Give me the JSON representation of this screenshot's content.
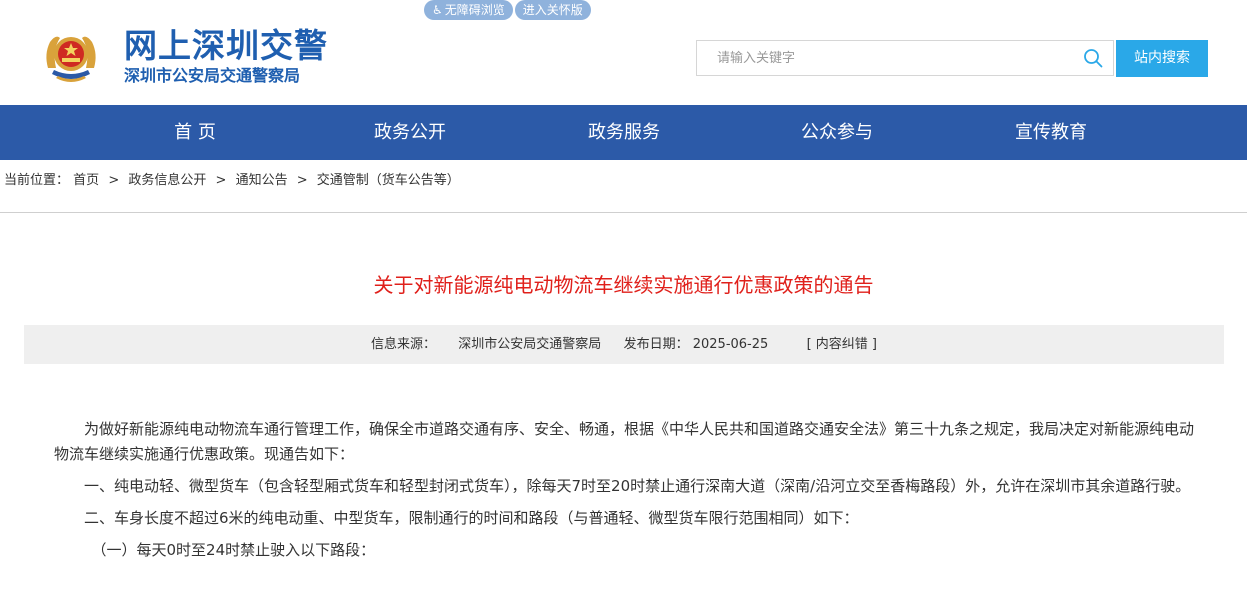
{
  "accessibility": {
    "barrier_free_label": "无障碍浏览",
    "elderly_mode_label": "进入关怀版"
  },
  "site": {
    "title": "网上深圳交警",
    "subtitle": "深圳市公安局交通警察局"
  },
  "search": {
    "placeholder": "请输入关键字",
    "value": "",
    "button_label": "站内搜索"
  },
  "nav": {
    "items": [
      {
        "label": "首 页"
      },
      {
        "label": "政务公开"
      },
      {
        "label": "政务服务"
      },
      {
        "label": "公众参与"
      },
      {
        "label": "宣传教育"
      }
    ]
  },
  "breadcrumb": {
    "prefix": "当前位置：",
    "items": [
      "首页",
      "政务信息公开",
      "通知公告",
      "交通管制（货车公告等）"
    ],
    "separator": ">"
  },
  "article": {
    "title": "关于对新能源纯电动物流车继续实施通行优惠政策的通告",
    "source_label": "信息来源：",
    "source_value": "深圳市公安局交通警察局",
    "date_label": "发布日期：",
    "date_value": "2025-06-25",
    "correction_label": "[ 内容纠错 ]",
    "paragraphs": [
      "为做好新能源纯电动物流车通行管理工作，确保全市道路交通有序、安全、畅通，根据《中华人民共和国道路交通安全法》第三十九条之规定，我局决定对新能源纯电动物流车继续实施通行优惠政策。现通告如下：",
      "一、纯电动轻、微型货车（包含轻型厢式货车和轻型封闭式货车），除每天7时至20时禁止通行深南大道（深南/沿河立交至香梅路段）外，允许在深圳市其余道路行驶。",
      "二、车身长度不超过6米的纯电动重、中型货车，限制通行的时间和路段（与普通轻、微型货车限行范围相同）如下：",
      "（一）每天0时至24时禁止驶入以下路段："
    ]
  },
  "colors": {
    "brand_blue": "#1f5fb0",
    "nav_bg": "#2c5aa8",
    "search_button": "#2aa8e8",
    "title_red": "#e0201b",
    "meta_bg": "#efefef"
  }
}
